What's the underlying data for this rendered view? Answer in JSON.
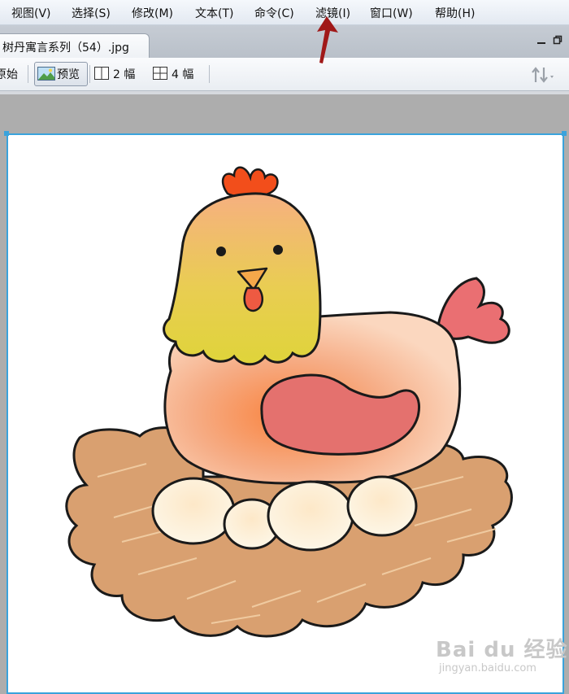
{
  "menu": {
    "items": [
      {
        "label": "视图(V)"
      },
      {
        "label": "选择(S)"
      },
      {
        "label": "修改(M)"
      },
      {
        "label": "文本(T)"
      },
      {
        "label": "命令(C)"
      },
      {
        "label": "滤镜(I)"
      },
      {
        "label": "窗口(W)"
      },
      {
        "label": "帮助(H)"
      }
    ]
  },
  "document": {
    "tab_title": "树丹寓言系列（54）.jpg"
  },
  "view_toolbar": {
    "original_label": "原始",
    "preview_label": "预览",
    "two_up_label": "2 幅",
    "four_up_label": "4 幅"
  },
  "watermark": {
    "main": "Bai du 经验",
    "sub": "jingyan.baidu.com"
  },
  "colors": {
    "selection_border": "#3aa3dc",
    "annotation_arrow": "#a01818",
    "hen_head": "#e7d24a",
    "hen_body": "#f49a6a",
    "hen_wing": "#e6716f",
    "nest": "#d79a6a",
    "eggs": "#fbf1dc"
  }
}
